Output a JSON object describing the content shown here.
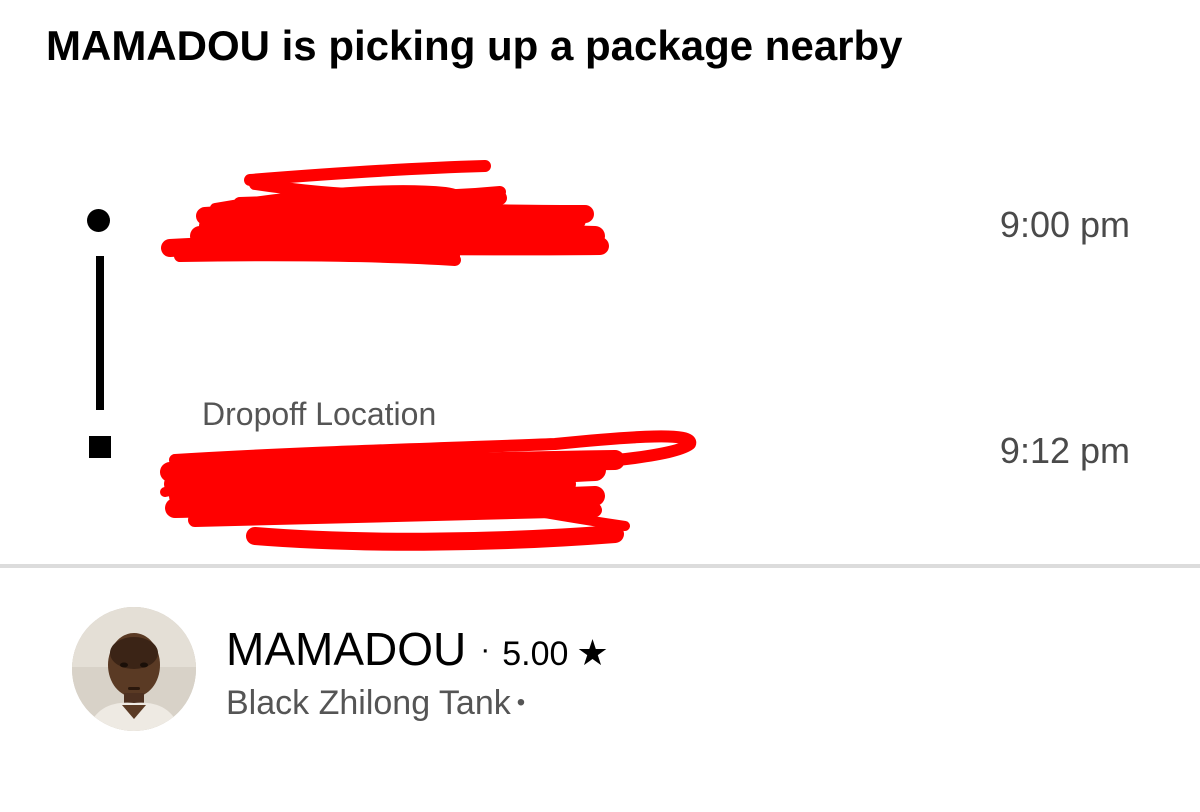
{
  "headline": "MAMADOU is picking up a package nearby",
  "trip": {
    "pickup": {
      "time": "9:00 pm"
    },
    "dropoff": {
      "label": "Dropoff Location",
      "time": "9:12 pm"
    },
    "redaction_color": "#ff0000"
  },
  "driver": {
    "name": "MAMADOU",
    "separator": "·",
    "rating": "5.00",
    "rating_icon": "star-icon",
    "vehicle": "Black Zhilong Tank",
    "vehicle_separator": "•"
  }
}
